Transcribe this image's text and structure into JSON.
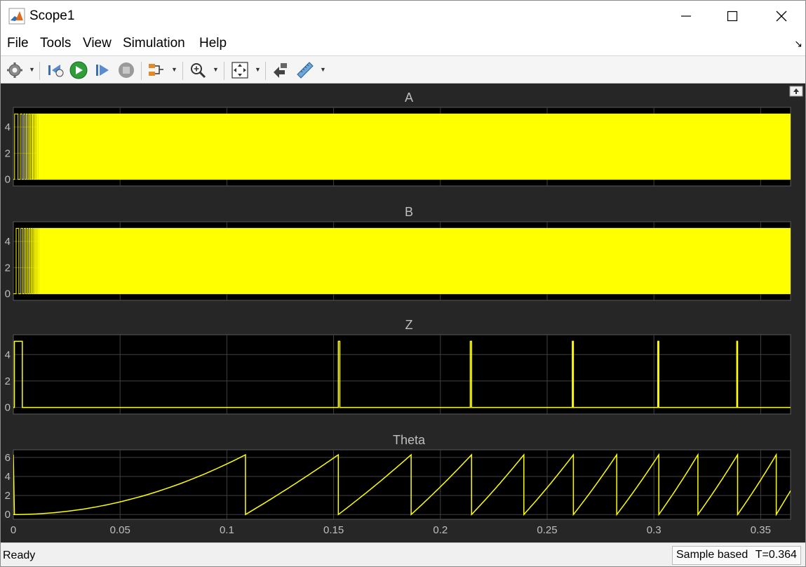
{
  "window": {
    "title": "Scope1",
    "minimize_glyph": "—",
    "maximize_glyph": "☐",
    "close_glyph": "✕"
  },
  "menu": {
    "items": [
      "File",
      "Tools",
      "View",
      "Simulation",
      "Help"
    ],
    "dock_icon": "undock-arrow-icon"
  },
  "toolbar": {
    "buttons": [
      "settings-gear-icon",
      "step-back-icon",
      "run-icon",
      "step-forward-icon",
      "stop-icon",
      "signal-triggers-icon",
      "zoom-in-icon",
      "scale-axes-icon",
      "highlight-block-icon",
      "measurements-ruler-icon"
    ]
  },
  "colors": {
    "trace": "#ffff00",
    "plot_bg": "#000000",
    "figure_bg": "#262626",
    "grid": "#3f3f3f",
    "text": "#bfbfbf"
  },
  "chart_data": [
    {
      "type": "line",
      "title": "A",
      "xlim": [
        0,
        0.364
      ],
      "ylim": [
        -0.5,
        5.5
      ],
      "yticks": [
        0,
        2,
        4
      ],
      "description_values": "square wave between 0 and 5 with rapidly increasing frequency",
      "series": [
        {
          "values_low": 0,
          "values_high": 5
        }
      ]
    },
    {
      "type": "line",
      "title": "B",
      "xlim": [
        0,
        0.364
      ],
      "ylim": [
        -0.5,
        5.5
      ],
      "yticks": [
        0,
        2,
        4
      ],
      "series": [
        {
          "values_low": 0,
          "values_high": 5
        }
      ]
    },
    {
      "type": "line",
      "title": "Z",
      "xlim": [
        0,
        0.364
      ],
      "ylim": [
        -0.5,
        5.5
      ],
      "yticks": [
        0,
        2,
        4
      ],
      "series": [
        {
          "pulses": [
            {
              "start": 0.0005,
              "end": 0.0042,
              "height": 5
            },
            {
              "start": 0.1522,
              "end": 0.1529,
              "height": 5
            },
            {
              "start": 0.214,
              "end": 0.2146,
              "height": 5
            },
            {
              "start": 0.2618,
              "end": 0.2623,
              "height": 5
            },
            {
              "start": 0.3018,
              "end": 0.3023,
              "height": 5
            },
            {
              "start": 0.3388,
              "end": 0.3392,
              "height": 5
            }
          ]
        }
      ]
    },
    {
      "type": "line",
      "title": "Theta",
      "xlim": [
        0,
        0.364
      ],
      "ylim": [
        -0.5,
        6.8
      ],
      "yticks": [
        0,
        2,
        4,
        6
      ],
      "series": [
        {
          "resets": [
            0,
            0.1087,
            0.1522,
            0.1863,
            0.2146,
            0.2391,
            0.2623,
            0.2826,
            0.3023,
            0.3206,
            0.3392,
            0.3573
          ],
          "peak": 6.28,
          "end_value": 2.5
        }
      ]
    }
  ],
  "xaxis": {
    "ticks": [
      0,
      0.05,
      0.1,
      0.15,
      0.2,
      0.25,
      0.3,
      0.35
    ],
    "tick_labels": [
      "0",
      "0.05",
      "0.1",
      "0.15",
      "0.2",
      "0.25",
      "0.3",
      "0.35"
    ]
  },
  "status": {
    "ready": "Ready",
    "sample_based": "Sample based",
    "time": "T=0.364"
  }
}
